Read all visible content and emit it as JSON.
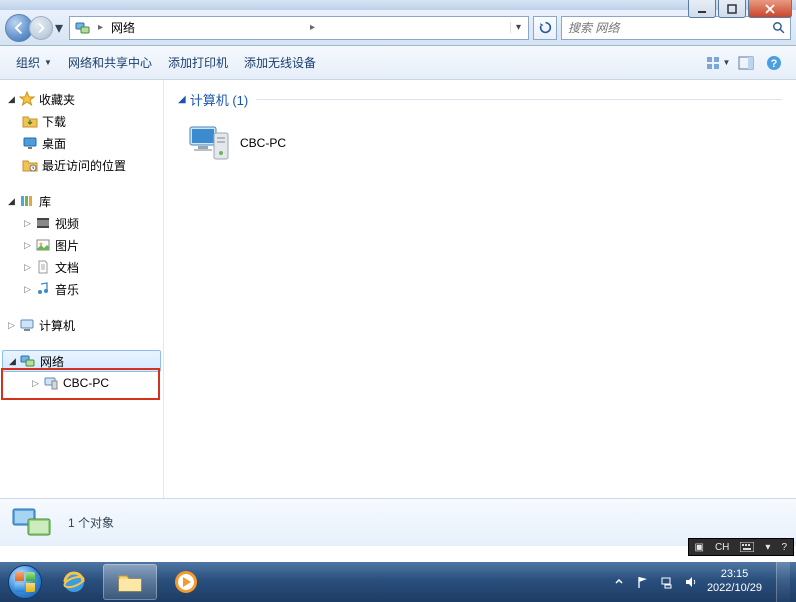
{
  "window_controls": {
    "minimize": "min",
    "maximize": "max",
    "close": "close"
  },
  "address": {
    "location": "网络",
    "refresh_label": "刷新"
  },
  "search": {
    "placeholder": "搜索 网络"
  },
  "toolbar": {
    "organize": "组织",
    "network_center": "网络和共享中心",
    "add_printer": "添加打印机",
    "add_wireless": "添加无线设备"
  },
  "tree": {
    "favorites": "收藏夹",
    "downloads": "下载",
    "desktop": "桌面",
    "recent": "最近访问的位置",
    "libraries": "库",
    "videos": "视频",
    "pictures": "图片",
    "documents": "文档",
    "music": "音乐",
    "computer": "计算机",
    "network": "网络",
    "network_child": "CBC-PC"
  },
  "content": {
    "section_label": "计算机 (1)",
    "items": [
      {
        "name": "CBC-PC"
      }
    ]
  },
  "status": {
    "text": "1 个对象"
  },
  "langbar": {
    "lang": "CH"
  },
  "system_tray": {
    "time": "23:15",
    "date": "2022/10/29"
  }
}
